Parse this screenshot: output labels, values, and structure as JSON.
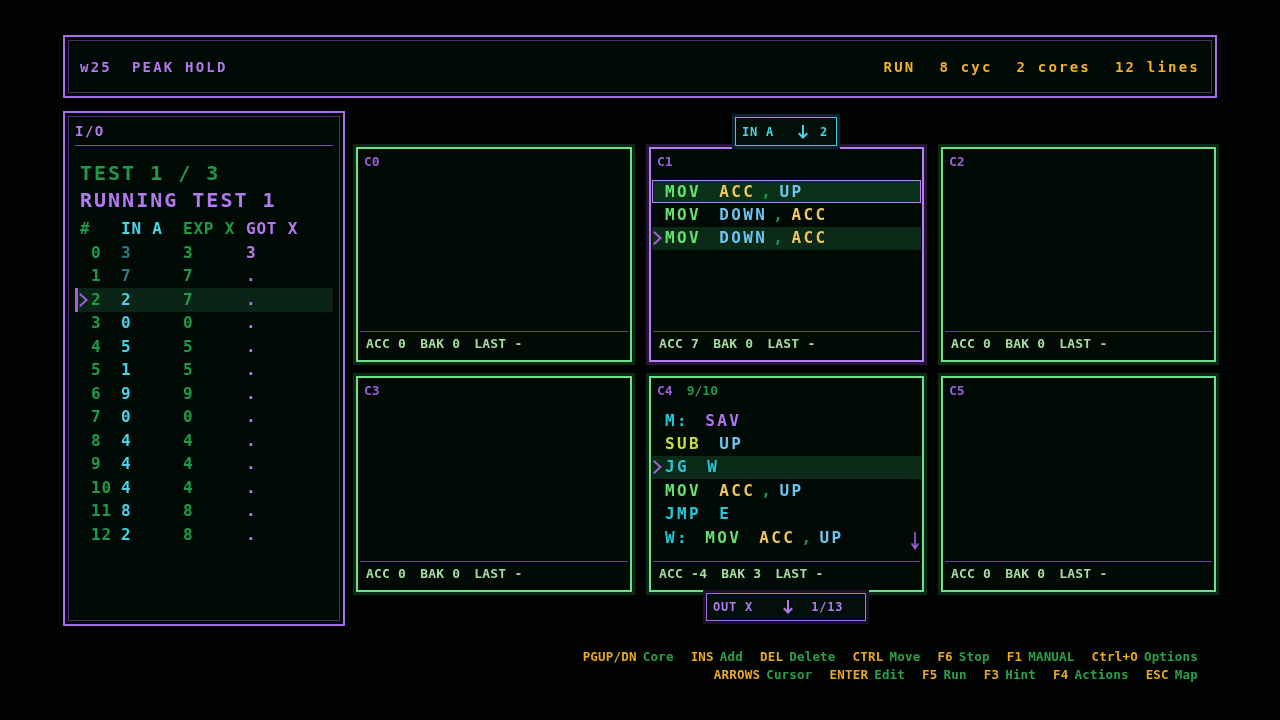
{
  "header": {
    "puzzle_id": "w25",
    "title": "PEAK HOLD",
    "status": "RUN",
    "stats": [
      "8 cyc",
      "2 cores",
      "12 lines"
    ]
  },
  "io_panel": {
    "title": "I/O",
    "test_label": "TEST 1 / 3",
    "status_text": "RUNNING TEST 1",
    "columns": [
      {
        "label": "#",
        "kind": "index"
      },
      {
        "label": "IN A",
        "kind": "input"
      },
      {
        "label": "EXP X",
        "kind": "expected"
      },
      {
        "label": "GOT X",
        "kind": "output"
      }
    ],
    "rows": [
      {
        "cells": [
          "0",
          "3",
          "3",
          "3"
        ],
        "consumed": true,
        "selected": false
      },
      {
        "cells": [
          "1",
          "7",
          "7",
          "."
        ],
        "consumed": true,
        "selected": false
      },
      {
        "cells": [
          "2",
          "2",
          "7",
          "."
        ],
        "consumed": false,
        "selected": true
      },
      {
        "cells": [
          "3",
          "0",
          "0",
          "."
        ],
        "consumed": false,
        "selected": false
      },
      {
        "cells": [
          "4",
          "5",
          "5",
          "."
        ],
        "consumed": false,
        "selected": false
      },
      {
        "cells": [
          "5",
          "1",
          "5",
          "."
        ],
        "consumed": false,
        "selected": false
      },
      {
        "cells": [
          "6",
          "9",
          "9",
          "."
        ],
        "consumed": false,
        "selected": false
      },
      {
        "cells": [
          "7",
          "0",
          "0",
          "."
        ],
        "consumed": false,
        "selected": false
      },
      {
        "cells": [
          "8",
          "4",
          "4",
          "."
        ],
        "consumed": false,
        "selected": false
      },
      {
        "cells": [
          "9",
          "4",
          "4",
          "."
        ],
        "consumed": false,
        "selected": false
      },
      {
        "cells": [
          "10",
          "4",
          "4",
          "."
        ],
        "consumed": false,
        "selected": false
      },
      {
        "cells": [
          "11",
          "8",
          "8",
          "."
        ],
        "consumed": false,
        "selected": false
      },
      {
        "cells": [
          "12",
          "2",
          "8",
          "."
        ],
        "consumed": false,
        "selected": false
      }
    ]
  },
  "cores": [
    {
      "name": "C0",
      "selected": false,
      "more_below": false,
      "registers": [
        "ACC 0",
        "BAK 0",
        "LAST -"
      ]
    },
    {
      "name": "C1",
      "selected": true,
      "more_below": false,
      "ports": [
        {
          "kind": "input",
          "label": "IN A",
          "value": "2"
        }
      ],
      "lines": [
        {
          "selected": false,
          "active": true,
          "tokens": [
            {
              "text": "MOV",
              "kind": "move"
            },
            {
              "text": "ACC",
              "kind": "reg"
            },
            {
              "text": ",",
              "kind": "sep"
            },
            {
              "text": "UP",
              "kind": "port"
            }
          ]
        },
        {
          "selected": false,
          "active": false,
          "tokens": [
            {
              "text": "MOV",
              "kind": "move"
            },
            {
              "text": "DOWN",
              "kind": "port"
            },
            {
              "text": ",",
              "kind": "sep"
            },
            {
              "text": "ACC",
              "kind": "reg"
            }
          ]
        },
        {
          "selected": true,
          "active": false,
          "tokens": [
            {
              "text": "MOV",
              "kind": "move"
            },
            {
              "text": "DOWN",
              "kind": "port"
            },
            {
              "text": ",",
              "kind": "sep"
            },
            {
              "text": "ACC",
              "kind": "reg"
            }
          ]
        }
      ],
      "registers": [
        "ACC 7",
        "BAK 0",
        "LAST -"
      ]
    },
    {
      "name": "C2",
      "selected": false,
      "more_below": false,
      "registers": [
        "ACC 0",
        "BAK 0",
        "LAST -"
      ]
    },
    {
      "name": "C3",
      "selected": false,
      "more_below": false,
      "registers": [
        "ACC 0",
        "BAK 0",
        "LAST -"
      ]
    },
    {
      "name": "C4",
      "count": "9/10",
      "selected": false,
      "more_below": true,
      "ports": [
        {
          "kind": "output",
          "label": "OUT X",
          "value": "1/13"
        }
      ],
      "lines": [
        {
          "selected": false,
          "active": false,
          "tokens": [
            {
              "text": "M:",
              "kind": "label"
            },
            {
              "text": "SAV",
              "kind": "save"
            }
          ]
        },
        {
          "selected": false,
          "active": false,
          "tokens": [
            {
              "text": "SUB",
              "kind": "arith"
            },
            {
              "text": "UP",
              "kind": "port"
            }
          ]
        },
        {
          "selected": true,
          "active": false,
          "tokens": [
            {
              "text": "JG",
              "kind": "jump"
            },
            {
              "text": "W",
              "kind": "target"
            }
          ]
        },
        {
          "selected": false,
          "active": false,
          "tokens": [
            {
              "text": "MOV",
              "kind": "move"
            },
            {
              "text": "ACC",
              "kind": "reg"
            },
            {
              "text": ",",
              "kind": "sep"
            },
            {
              "text": "UP",
              "kind": "port"
            }
          ]
        },
        {
          "selected": false,
          "active": false,
          "tokens": [
            {
              "text": "JMP",
              "kind": "jump"
            },
            {
              "text": "E",
              "kind": "target"
            }
          ]
        },
        {
          "selected": false,
          "active": false,
          "tokens": [
            {
              "text": "W:",
              "kind": "label"
            },
            {
              "text": "MOV",
              "kind": "move"
            },
            {
              "text": "ACC",
              "kind": "reg"
            },
            {
              "text": ",",
              "kind": "sep"
            },
            {
              "text": "UP",
              "kind": "port"
            }
          ]
        }
      ],
      "registers": [
        "ACC -4",
        "BAK 3",
        "LAST -"
      ]
    },
    {
      "name": "C5",
      "selected": false,
      "more_below": false,
      "registers": [
        "ACC 0",
        "BAK 0",
        "LAST -"
      ]
    }
  ],
  "hints": [
    [
      {
        "key": "PGUP/DN",
        "action": "Core"
      },
      {
        "key": "INS",
        "action": "Add"
      },
      {
        "key": "DEL",
        "action": "Delete"
      },
      {
        "key": "CTRL",
        "action": "Move"
      },
      {
        "key": "F6",
        "action": "Stop"
      },
      {
        "key": "F1",
        "action": "MANUAL"
      },
      {
        "key": "Ctrl+O",
        "action": "Options"
      }
    ],
    [
      {
        "key": "ARROWS",
        "action": "Cursor"
      },
      {
        "key": "ENTER",
        "action": "Edit"
      },
      {
        "key": "F5",
        "action": "Run"
      },
      {
        "key": "F3",
        "action": "Hint"
      },
      {
        "key": "F4",
        "action": "Actions"
      },
      {
        "key": "ESC",
        "action": "Map"
      }
    ]
  ]
}
